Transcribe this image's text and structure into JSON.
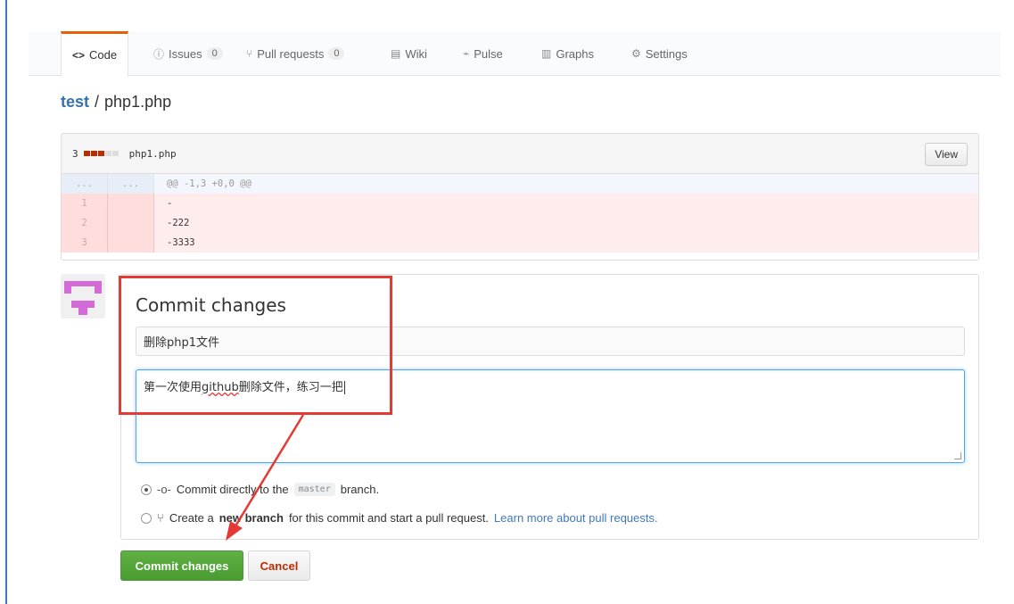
{
  "tabs": [
    {
      "label": "Code",
      "icon": "code-icon",
      "glyph": "<>",
      "counter": null
    },
    {
      "label": "Issues",
      "icon": "issue-icon",
      "glyph": "ⓘ",
      "counter": "0"
    },
    {
      "label": "Pull requests",
      "icon": "pull-request-icon",
      "glyph": "⑂",
      "counter": "0"
    },
    {
      "label": "Wiki",
      "icon": "book-icon",
      "glyph": "▤",
      "counter": null
    },
    {
      "label": "Pulse",
      "icon": "pulse-icon",
      "glyph": "⌁",
      "counter": null
    },
    {
      "label": "Graphs",
      "icon": "graph-icon",
      "glyph": "▥",
      "counter": null
    },
    {
      "label": "Settings",
      "icon": "gear-icon",
      "glyph": "⚙",
      "counter": null
    }
  ],
  "breadcrumb": {
    "repo": "test",
    "separator": "/",
    "file": "php1.php"
  },
  "file": {
    "changes": "3",
    "name": "php1.php",
    "view_label": "View",
    "hunk_header": "@@ -1,3 +0,0 @@",
    "hunk_ln": "...",
    "lines": [
      {
        "num": "1",
        "text": "-"
      },
      {
        "num": "2",
        "text": "-222"
      },
      {
        "num": "3",
        "text": "-3333"
      }
    ]
  },
  "commit": {
    "title": "Commit changes",
    "summary_value": "删除php1文件",
    "desc_before": "第一次使用",
    "desc_spell": "github",
    "desc_after": "删除文件，练习一把",
    "option_direct_prefix": "Commit directly to the",
    "option_direct_branch": "master",
    "option_direct_suffix": "branch.",
    "option_new_prefix": "Create a",
    "option_new_bold": "new branch",
    "option_new_suffix": "for this commit and start a pull request.",
    "option_new_link": "Learn more about pull requests.",
    "commit_button": "Commit changes",
    "cancel_button": "Cancel"
  },
  "colors": {
    "accent": "#e36209",
    "commit_green": "#55a532",
    "delete_bg": "#ffecec",
    "annotation_red": "#e53935",
    "link": "#4078c0"
  }
}
